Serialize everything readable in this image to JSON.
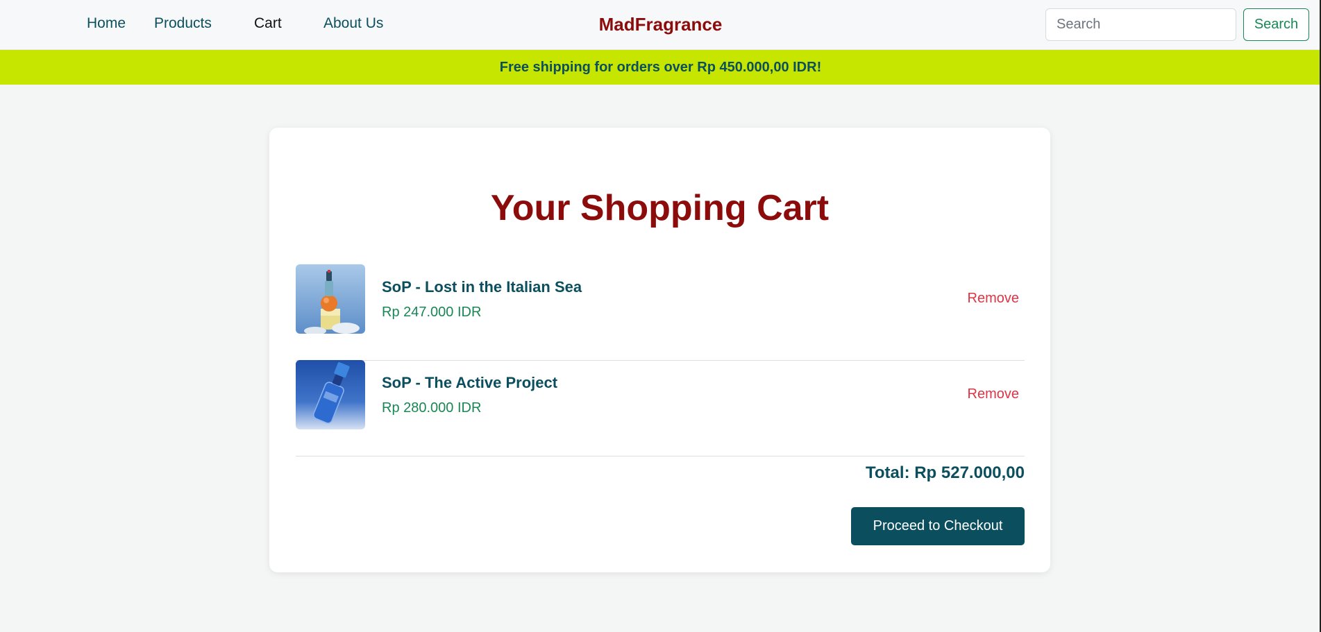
{
  "nav": {
    "links": [
      "Home",
      "Products",
      "Cart",
      "About Us"
    ],
    "brand": "MadFragrance",
    "search_placeholder": "Search",
    "search_button": "Search"
  },
  "banner": {
    "text": "Free shipping for orders over Rp 450.000,00 IDR!"
  },
  "cart": {
    "title": "Your Shopping Cart",
    "items": [
      {
        "name": "SoP - Lost in the Italian Sea",
        "price": "Rp 247.000 IDR",
        "remove_label": "Remove",
        "image_icon": "perfume-bottle-orange-image"
      },
      {
        "name": "SoP - The Active Project",
        "price": "Rp 280.000 IDR",
        "remove_label": "Remove",
        "image_icon": "perfume-bottle-blue-image"
      }
    ],
    "total": "Total: Rp 527.000,00",
    "checkout_label": "Proceed to Checkout"
  },
  "colors": {
    "brand": "#8c0c0c",
    "accent": "#0b4f5e",
    "banner": "#c6e600",
    "price": "#198754",
    "remove": "#dc3545"
  }
}
